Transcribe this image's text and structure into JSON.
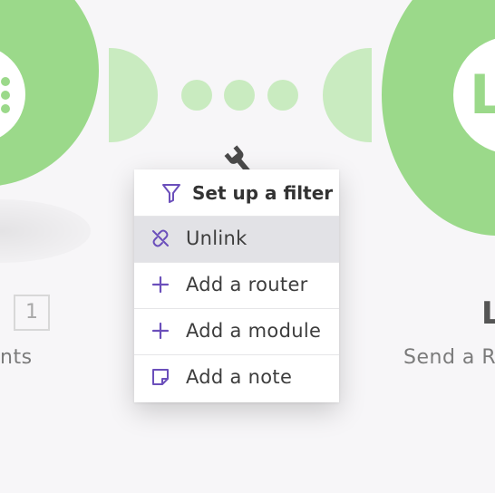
{
  "colors": {
    "module_green": "#9bd98a",
    "connector_green": "#c9ebc0",
    "menu_icon_purple": "#6b4fbb",
    "active_item_bg": "#e2e2e6"
  },
  "left_module": {
    "operation_count": "1",
    "label_fragment": "nts",
    "icon": "list-icon"
  },
  "right_module": {
    "title_fragment": "L",
    "subtitle_fragment": "Send a R",
    "badge_letter": "L"
  },
  "connector": {
    "icon": "wrench-icon"
  },
  "context_menu": {
    "header": {
      "label": "Set up a filter",
      "icon": "filter-icon"
    },
    "items": [
      {
        "label": "Unlink",
        "icon": "unlink-icon",
        "active": true
      },
      {
        "label": "Add a router",
        "icon": "plus-icon",
        "active": false
      },
      {
        "label": "Add a module",
        "icon": "plus-icon",
        "active": false
      },
      {
        "label": "Add a note",
        "icon": "note-icon",
        "active": false
      }
    ]
  }
}
